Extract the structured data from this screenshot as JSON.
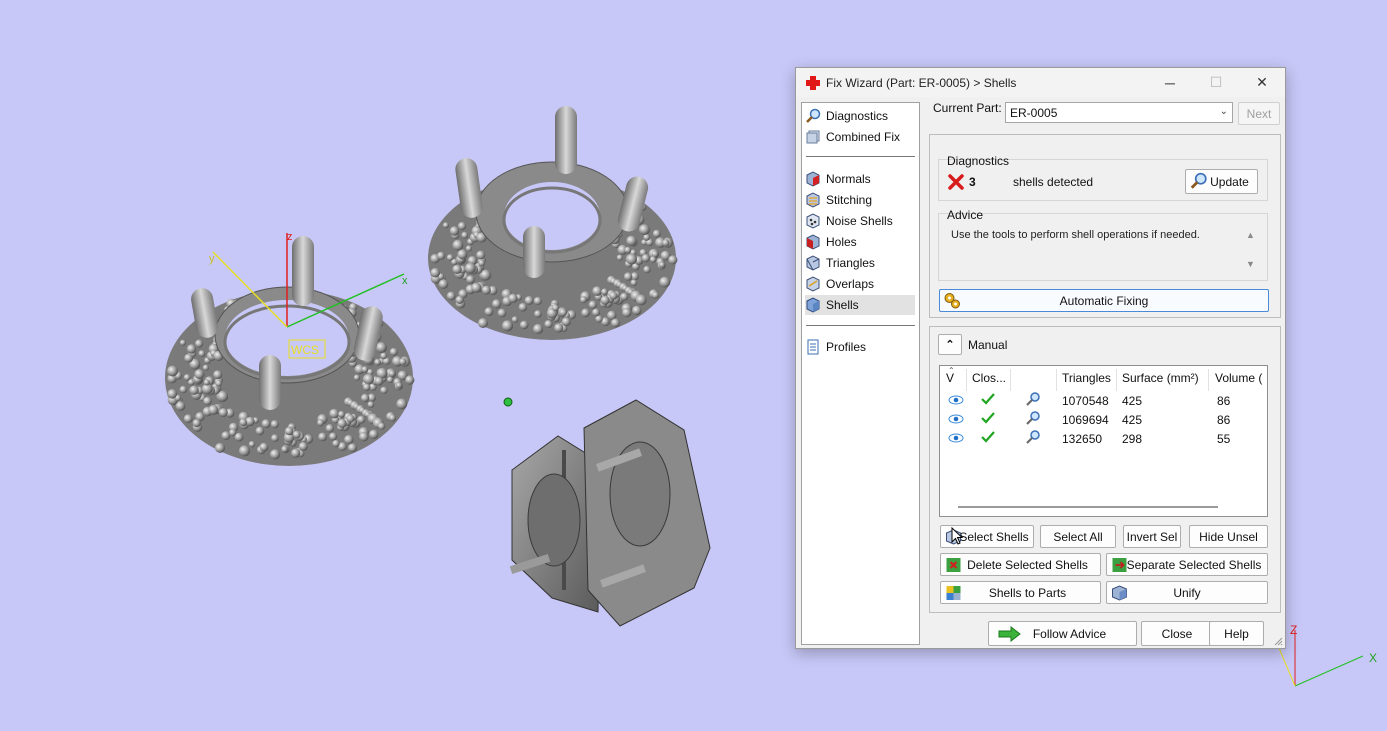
{
  "viewport": {
    "background": "#c8c8f8",
    "wcs_label": "WCS",
    "axis_labels": {
      "x": "x",
      "y": "y",
      "z": "z"
    },
    "corner_axis_labels": {
      "x": "X",
      "z": "Z"
    }
  },
  "dialog": {
    "title": "Fix Wizard (Part: ER-0005) > Shells",
    "window_buttons": {
      "minimize": "─",
      "maximize": "☐",
      "close": "✕"
    },
    "nav": {
      "top": [
        {
          "label": "Diagnostics",
          "icon": "diagnostics-icon"
        },
        {
          "label": "Combined Fix",
          "icon": "combined-fix-icon"
        }
      ],
      "tools": [
        {
          "label": "Normals",
          "icon": "normals-icon"
        },
        {
          "label": "Stitching",
          "icon": "stitching-icon"
        },
        {
          "label": "Noise Shells",
          "icon": "noise-shells-icon"
        },
        {
          "label": "Holes",
          "icon": "holes-icon"
        },
        {
          "label": "Triangles",
          "icon": "triangles-icon"
        },
        {
          "label": "Overlaps",
          "icon": "overlaps-icon"
        },
        {
          "label": "Shells",
          "icon": "shells-icon"
        }
      ],
      "bottom": [
        {
          "label": "Profiles",
          "icon": "profiles-icon"
        }
      ],
      "selected": "Shells"
    },
    "current_part_label": "Current Part:",
    "current_part_value": "ER-0005",
    "next_label": "Next",
    "diagnostics": {
      "title": "Diagnostics",
      "count": "3",
      "text": "shells detected",
      "update_label": "Update"
    },
    "advice": {
      "title": "Advice",
      "text": "Use the tools to perform shell operations if needed."
    },
    "automatic_fixing_label": "Automatic Fixing",
    "manual": {
      "label": "Manual",
      "columns": [
        "V",
        "Clos...",
        "",
        "Triangles",
        "Surface (mm²)",
        "Volume ("
      ],
      "rows": [
        {
          "triangles": "1070548",
          "surface": "425",
          "volume": "86"
        },
        {
          "triangles": "1069694",
          "surface": "425",
          "volume": "86"
        },
        {
          "triangles": "132650",
          "surface": "298",
          "volume": "55"
        }
      ]
    },
    "buttons": {
      "select_shells": "Select Shells",
      "select_all": "Select All",
      "invert_sel": "Invert Sel",
      "hide_unsel": "Hide Unsel",
      "delete_selected": "Delete Selected Shells",
      "separate_selected": "Separate Selected Shells",
      "shells_to_parts": "Shells to Parts",
      "unify": "Unify",
      "follow_advice": "Follow Advice",
      "close": "Close",
      "help": "Help"
    }
  }
}
